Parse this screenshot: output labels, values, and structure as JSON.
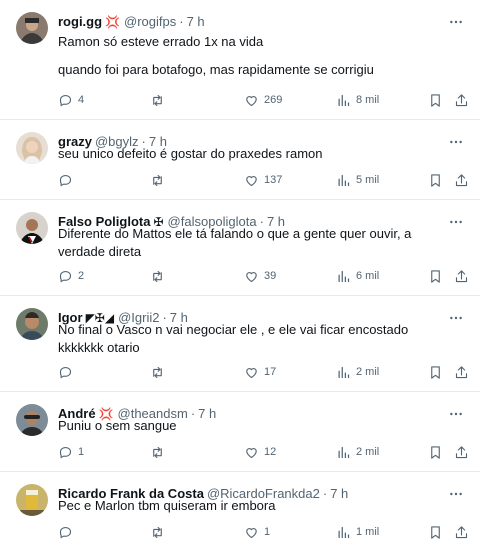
{
  "colors": {
    "text": "#0f1419",
    "muted": "#536471",
    "divider": "#e6e9eb",
    "badge_red": "#f4212e"
  },
  "icons": {
    "reply": "reply-icon",
    "retweet": "retweet-icon",
    "like": "heart-icon",
    "views": "views-bar-chart-icon",
    "bookmark": "bookmark-icon",
    "share": "share-icon",
    "more": "more-icon"
  },
  "tweets": [
    {
      "name": "rogi.gg",
      "badge": "💢",
      "handle": "@rogifps",
      "time": "7 h",
      "lines": [
        "Ramon só esteve errado 1x na vida",
        "quando foi para botafogo, mas rapidamente se corrigiu"
      ],
      "replies": "4",
      "retweets": "",
      "likes": "269",
      "views": "8 mil"
    },
    {
      "name": "grazy",
      "badge": "",
      "handle": "@bgylz",
      "time": "7 h",
      "lines": [
        "seu unico defeito é gostar do praxedes ramon"
      ],
      "replies": "",
      "retweets": "",
      "likes": "137",
      "views": "5 mil"
    },
    {
      "name": "Falso Poliglota",
      "badge": "✠",
      "handle": "@falsopoliglota",
      "time": "7 h",
      "lines": [
        "Diferente do Mattos ele tá falando o que a gente quer ouvir, a verdade direta"
      ],
      "replies": "2",
      "retweets": "",
      "likes": "39",
      "views": "6 mil"
    },
    {
      "name": "Igor",
      "badge": "◤✠◢",
      "handle": "@Igrii2",
      "time": "7 h",
      "lines": [
        "No final o Vasco n vai negociar ele , e ele vai ficar encostado kkkkkkk otario"
      ],
      "replies": "",
      "retweets": "",
      "likes": "17",
      "views": "2 mil"
    },
    {
      "name": "André",
      "badge": "💢",
      "handle": "@theandsm",
      "time": "7 h",
      "lines": [
        "Puniu o sem sangue"
      ],
      "replies": "1",
      "retweets": "",
      "likes": "12",
      "views": "2 mil"
    },
    {
      "name": "Ricardo Frank da Costa",
      "badge": "",
      "handle": "@RicardoFrankda2",
      "time": "7 h",
      "lines": [
        "Pec e Marlon tbm quiseram ir embora"
      ],
      "replies": "",
      "retweets": "",
      "likes": "1",
      "views": "1 mil"
    }
  ]
}
